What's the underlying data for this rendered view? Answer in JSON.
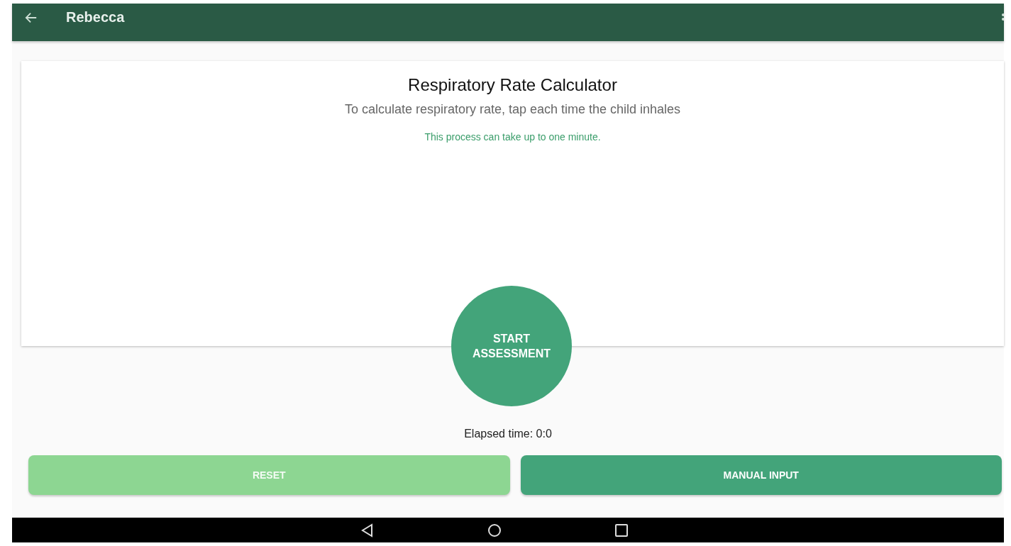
{
  "app_bar": {
    "title": "Rebecca"
  },
  "card": {
    "title": "Respiratory Rate Calculator",
    "subtitle": "To calculate respiratory rate, tap each time the child inhales",
    "note": "This process can take up to one minute."
  },
  "start_button": {
    "label": "START\nASSESSMENT"
  },
  "elapsed": "Elapsed time: 0:0",
  "buttons": [
    {
      "label": "RESET",
      "disabled": true
    },
    {
      "label": "MANUAL INPUT",
      "disabled": false
    }
  ]
}
